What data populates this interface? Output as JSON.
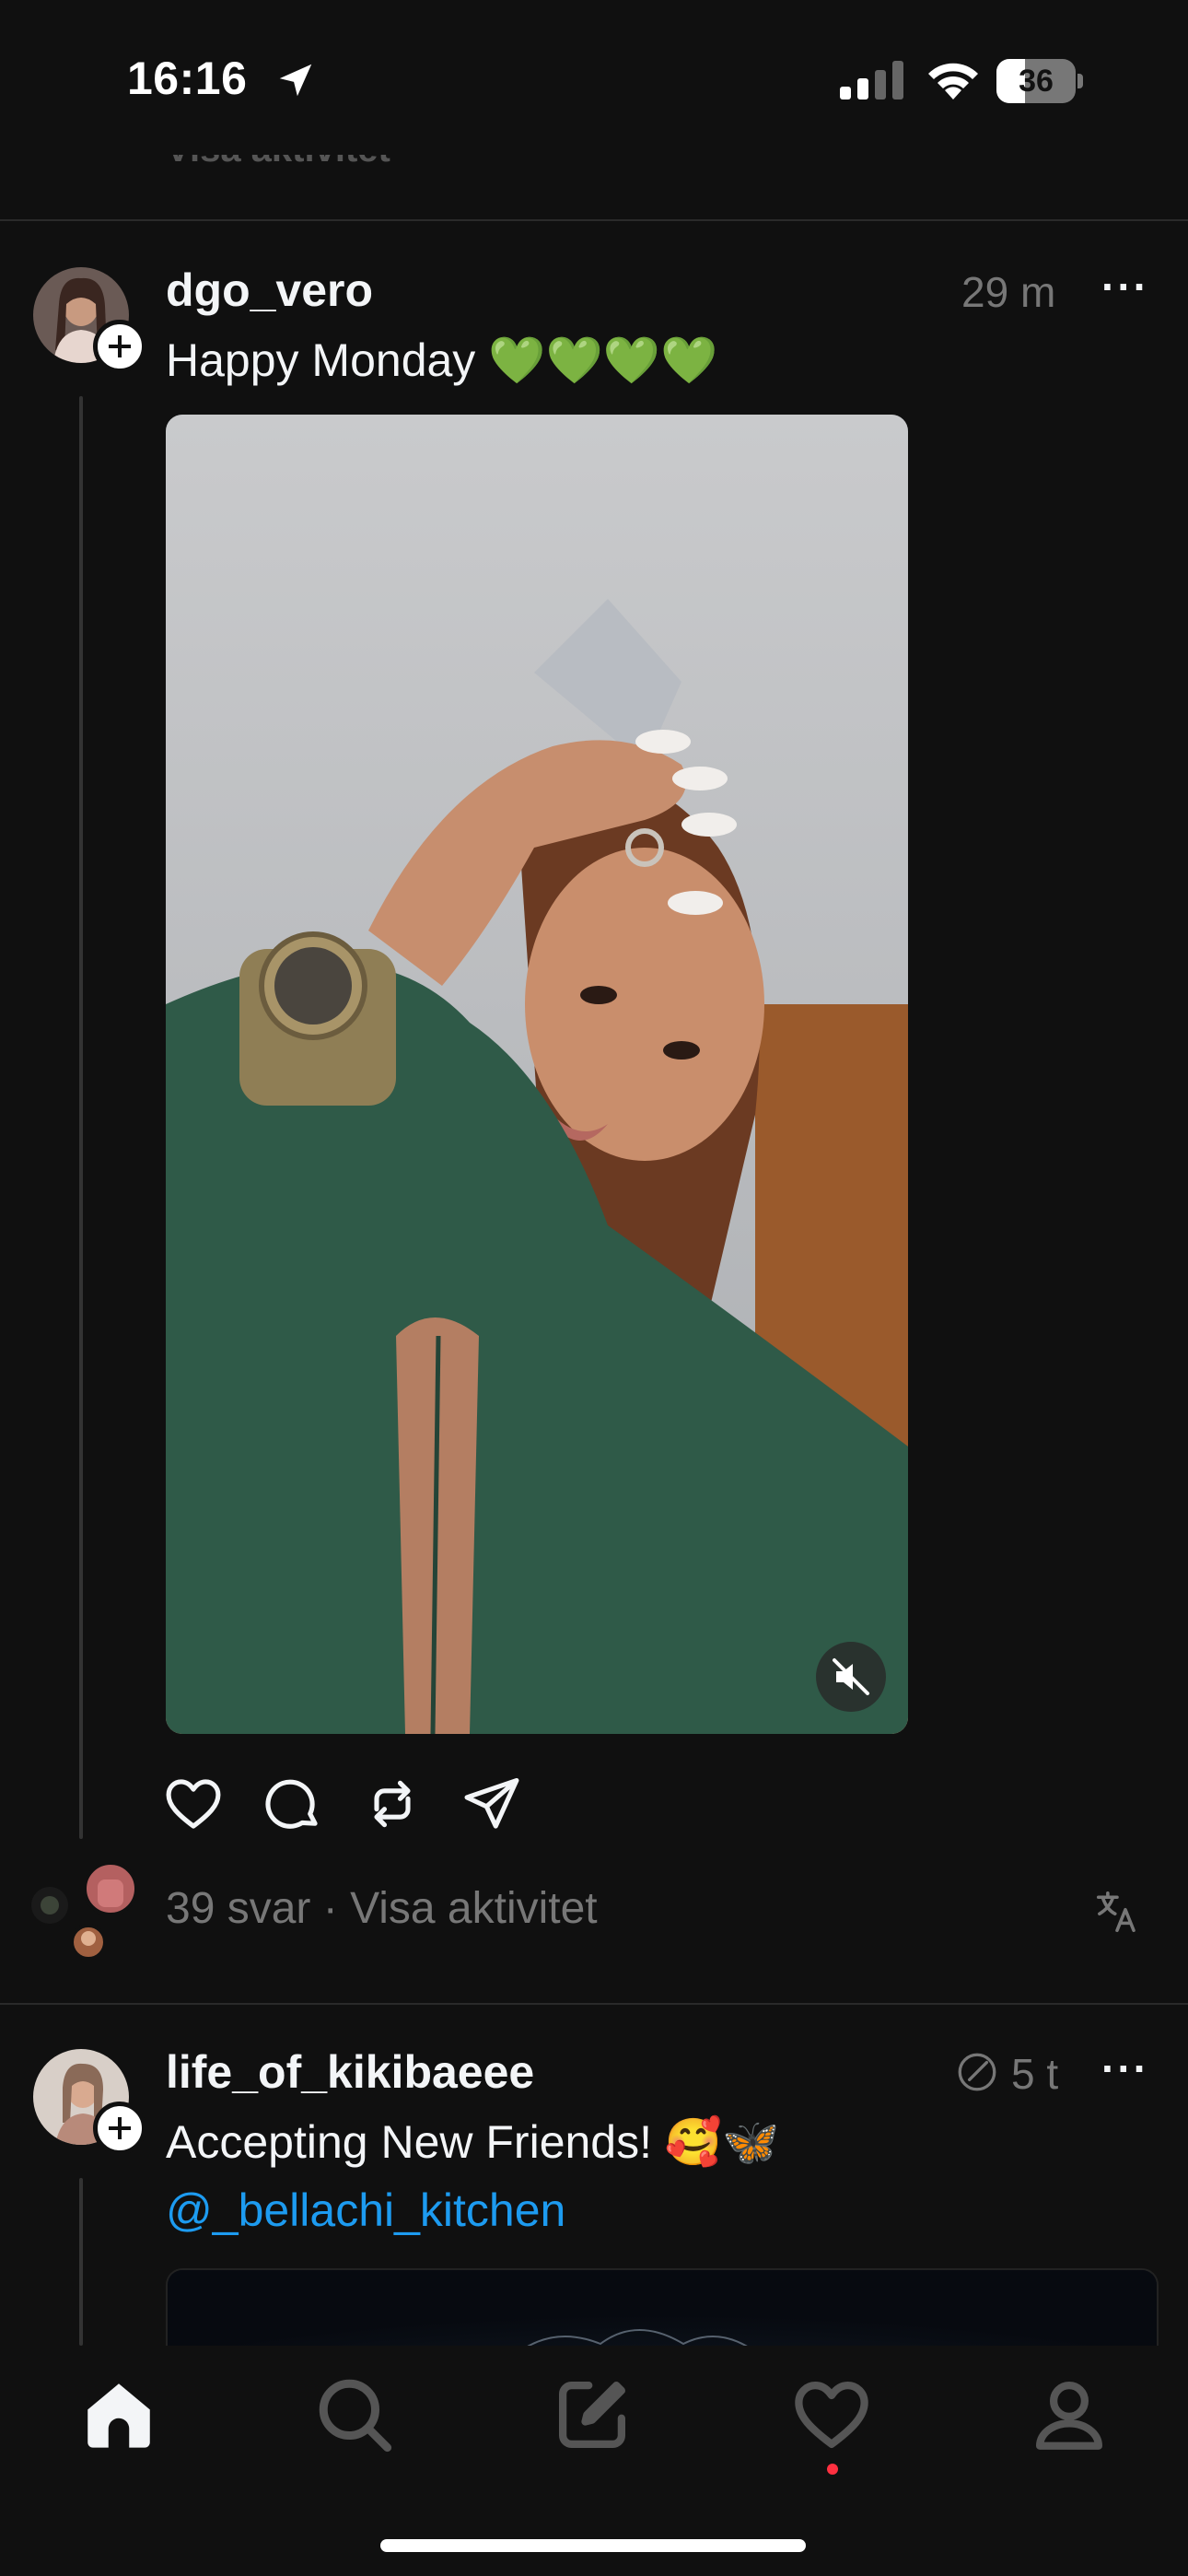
{
  "status_bar": {
    "time": "16:16",
    "battery": "36",
    "battery_level": 0.36
  },
  "top_partial_label": "Visa aktivitet",
  "posts": [
    {
      "username": "dgo_vero",
      "time": "29 m",
      "text": "Happy Monday 💚💚💚💚",
      "replies_text": "39 svar · Visa aktivitet"
    },
    {
      "username": "life_of_kikibaeee",
      "time": "5 t",
      "text": "Accepting New Friends! 🥰🦋",
      "mention": "@_bellachi_kitchen"
    }
  ],
  "more_label": "···",
  "icons": {
    "location": "location-arrow-icon",
    "signal": "cellular-signal-icon",
    "wifi": "wifi-icon",
    "like": "heart-icon",
    "comment": "comment-icon",
    "repost": "repost-icon",
    "share": "send-icon",
    "mute": "muted-speaker-icon",
    "translate": "translate-icon",
    "edited": "edited-icon",
    "home": "home-icon",
    "search": "search-icon",
    "compose": "compose-icon",
    "activity": "heart-icon",
    "profile": "profile-icon"
  },
  "colors": {
    "background": "#101010",
    "text": "#f3f5f7",
    "muted": "#777777",
    "link": "#1d9bf0",
    "notification": "#ff3040"
  }
}
